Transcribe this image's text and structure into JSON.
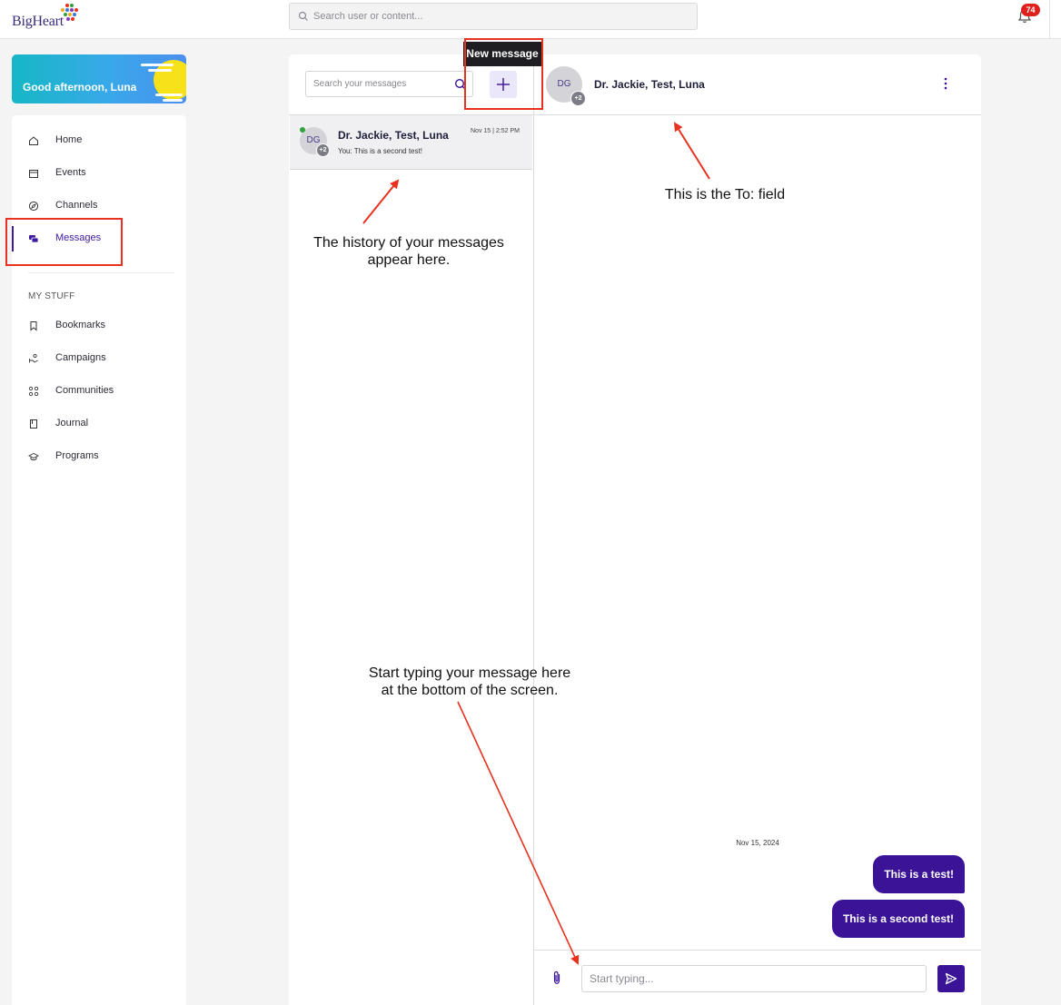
{
  "brand": {
    "logo_text": "BigHeart"
  },
  "topbar": {
    "search_placeholder": "Search user or content...",
    "notification_count": "74"
  },
  "greeting": {
    "text": "Good afternoon, Luna"
  },
  "sidebar": {
    "items": [
      {
        "label": "Home",
        "icon": "home-icon"
      },
      {
        "label": "Events",
        "icon": "calendar-icon"
      },
      {
        "label": "Channels",
        "icon": "compass-icon"
      },
      {
        "label": "Messages",
        "icon": "chat-icon",
        "active": true
      }
    ],
    "section_label": "MY STUFF",
    "my_stuff": [
      {
        "label": "Bookmarks",
        "icon": "bookmark-icon"
      },
      {
        "label": "Campaigns",
        "icon": "campaign-icon"
      },
      {
        "label": "Communities",
        "icon": "communities-icon"
      },
      {
        "label": "Journal",
        "icon": "journal-icon"
      },
      {
        "label": "Programs",
        "icon": "graduation-cap-icon"
      }
    ]
  },
  "messages": {
    "search_placeholder": "Search your messages",
    "new_message_tooltip": "New message",
    "conversations": [
      {
        "avatar_initials": "DG",
        "extra_count": "+2",
        "name": "Dr. Jackie, Test, Luna",
        "time": "Nov 15 | 2:52 PM",
        "preview": "You: This is a second test!"
      }
    ]
  },
  "thread": {
    "avatar_initials": "DG",
    "extra_count": "+2",
    "name": "Dr. Jackie, Test, Luna",
    "date_separator": "Nov 15, 2024",
    "messages": [
      {
        "text": "This is a test!"
      },
      {
        "text": "This is a second test!"
      }
    ],
    "composer_placeholder": "Start typing..."
  },
  "annotations": {
    "to_field": "This is the To: field",
    "history_line1": "The history of your messages",
    "history_line2": "appear here.",
    "typing_line1": "Start typing your message here",
    "typing_line2": "at the bottom of the screen."
  },
  "colors": {
    "accent": "#3a1396",
    "annotation_red": "#e8321f",
    "badge_red": "#e0201c",
    "online_green": "#2fa23a"
  }
}
